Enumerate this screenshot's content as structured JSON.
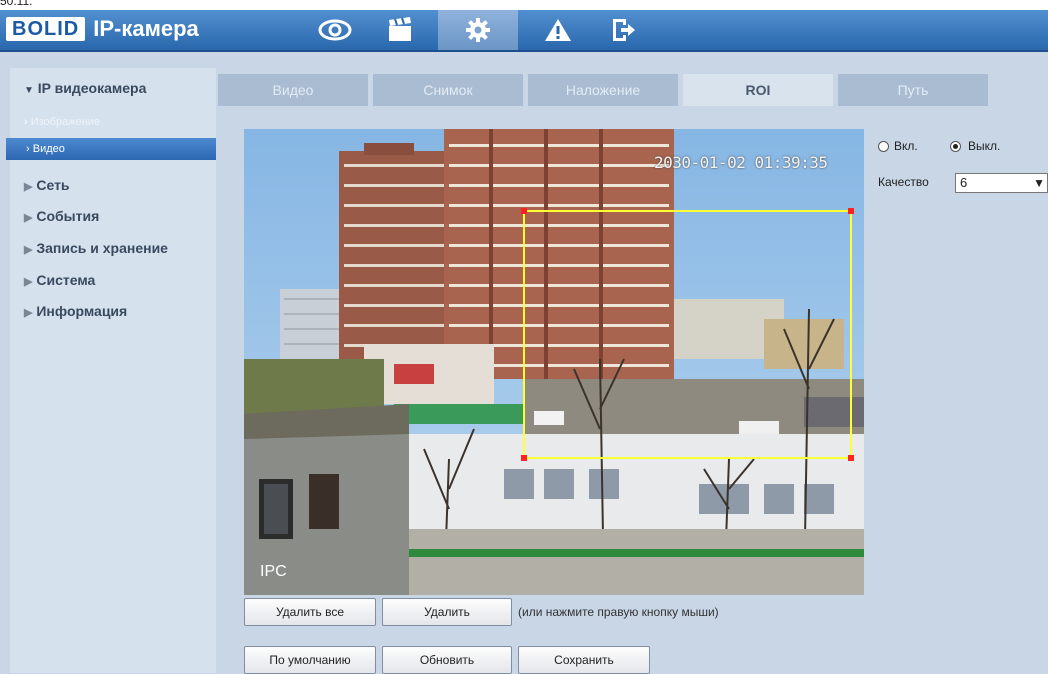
{
  "top_strip_text": "50.11.",
  "header": {
    "logo_mark": "BOLID",
    "title": "IP-камера",
    "nav": [
      {
        "name": "live-view",
        "icon": "eye-icon"
      },
      {
        "name": "playback",
        "icon": "clapperboard-icon"
      },
      {
        "name": "settings",
        "icon": "gear-icon",
        "active": true
      },
      {
        "name": "alarm",
        "icon": "warning-icon"
      },
      {
        "name": "logout",
        "icon": "exit-icon"
      }
    ]
  },
  "sidebar": {
    "section_title": "IP видеокамера",
    "sub_items": [
      "Изображение",
      "Видео"
    ],
    "active_sub": "Видео",
    "items": [
      "Сеть",
      "События",
      "Запись и хранение",
      "Система",
      "Информация"
    ]
  },
  "tabs": [
    "Видео",
    "Снимок",
    "Наложение",
    "ROI",
    "Путь"
  ],
  "active_tab": "ROI",
  "video": {
    "timestamp": "2030-01-02 01:39:35",
    "channel_label": "IPC"
  },
  "roi": {
    "on_label": "Вкл.",
    "off_label": "Выкл.",
    "selected": "off",
    "quality_label": "Качество",
    "quality_value": "6"
  },
  "buttons": {
    "delete_all": "Удалить все",
    "delete": "Удалить",
    "hint": "(или нажмите правую кнопку мыши)",
    "default": "По умолчанию",
    "refresh": "Обновить",
    "save": "Сохранить"
  },
  "colors": {
    "header_blue": "#2a67ad",
    "active_blue": "#2c68b2",
    "roi_yellow": "#ffff33",
    "roi_corner": "#ff2222"
  }
}
